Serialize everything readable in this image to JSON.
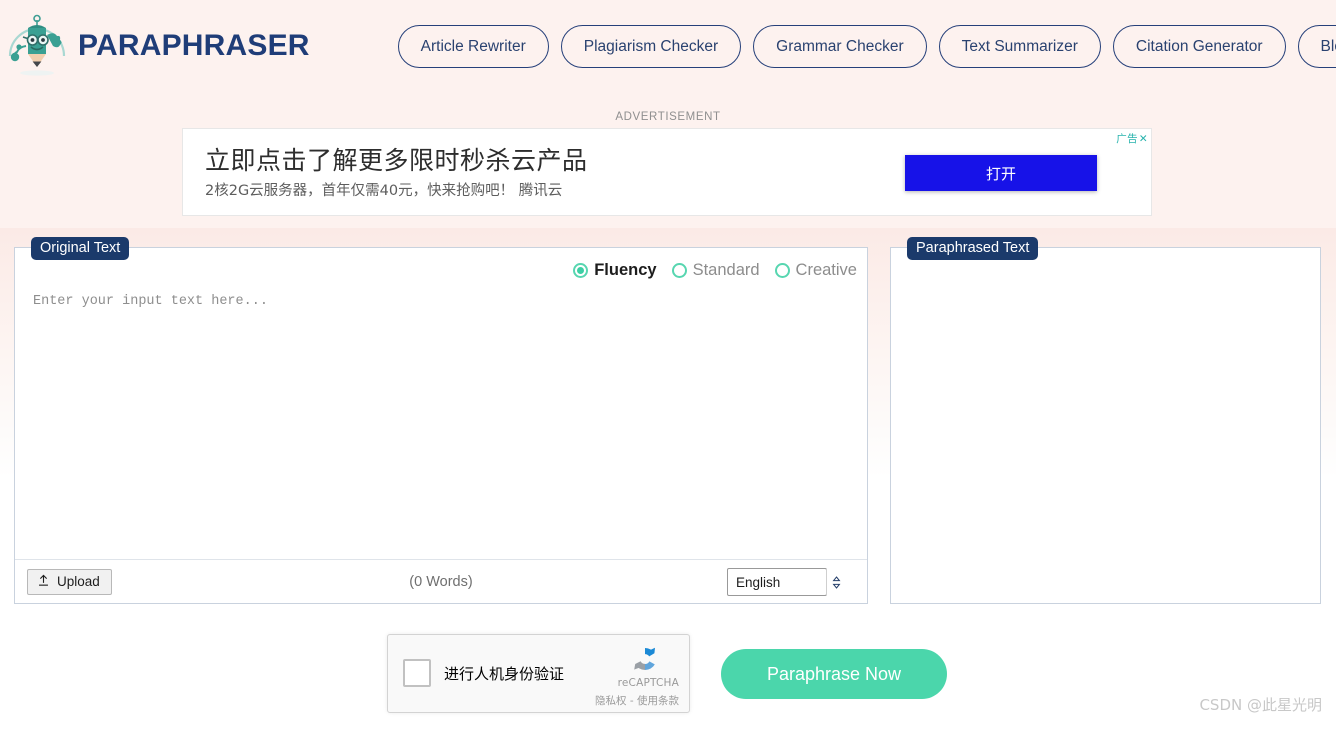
{
  "brand": {
    "name": "PARAPHRASER",
    "logo_icon": "paraphraser-pencil-mascot-logo"
  },
  "nav": {
    "items": [
      {
        "label": "Article Rewriter"
      },
      {
        "label": "Plagiarism Checker"
      },
      {
        "label": "Grammar Checker"
      },
      {
        "label": "Text Summarizer"
      },
      {
        "label": "Citation Generator"
      },
      {
        "label": "Blog"
      }
    ]
  },
  "ad": {
    "label": "ADVERTISEMENT",
    "headline": "立即点击了解更多限时秒杀云产品",
    "subtitle": "2核2G云服务器，首年仅需40元，快来抢购吧！ 腾讯云",
    "cta_label": "打开",
    "tag_label": "广告",
    "close_label": "✕"
  },
  "editor": {
    "left_badge": "Original Text",
    "right_badge": "Paraphrased Text",
    "input_value": "",
    "input_placeholder": "Enter your input text here...",
    "output_value": "",
    "word_count": "(0 Words)",
    "upload_label": "Upload",
    "upload_icon": "upload-icon",
    "language": {
      "selected": "English",
      "options": [
        "English"
      ]
    },
    "modes": [
      {
        "label": "Fluency",
        "selected": true
      },
      {
        "label": "Standard",
        "selected": false
      },
      {
        "label": "Creative",
        "selected": false
      }
    ]
  },
  "captcha": {
    "checkbox_label": "进行人机身份验证",
    "brand": "reCAPTCHA",
    "terms": "隐私权 - 使用条款",
    "logo_icon": "recaptcha-icon"
  },
  "actions": {
    "paraphrase_label": "Paraphrase Now"
  },
  "watermark": {
    "text": "CSDN @此星光明"
  },
  "colors": {
    "brand_navy": "#1f3d78",
    "badge_navy": "#1b3a6b",
    "accent_teal": "#4bd6ab",
    "header_pink": "#fdf2ef",
    "ad_blue": "#1712e8"
  }
}
